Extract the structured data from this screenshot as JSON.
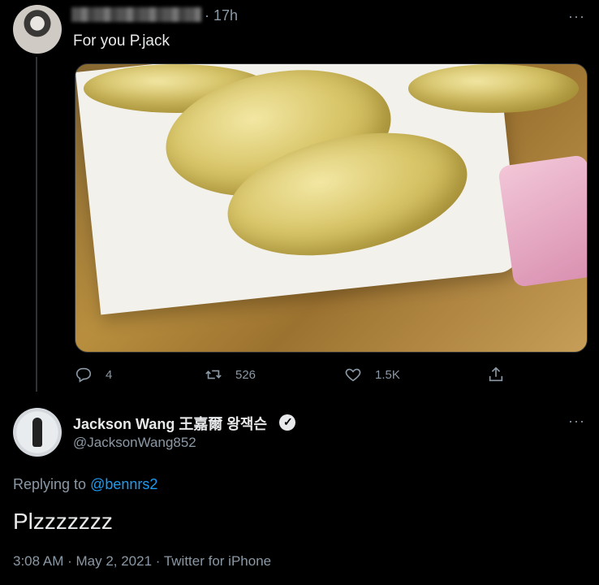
{
  "tweet1": {
    "time": "· 17h",
    "more": "···",
    "text": "For you P.jack",
    "actions": {
      "replies": "4",
      "retweets": "526",
      "likes": "1.5K"
    }
  },
  "tweet2": {
    "name": "Jackson Wang 王嘉爾 왕잭슨",
    "handle": "@JacksonWang852",
    "more": "···",
    "replying_prefix": "Replying to",
    "replying_to": "@bennrs2",
    "text": "Plzzzzzzz",
    "meta": "3:08 AM · May 2, 2021 · Twitter for iPhone"
  },
  "icons": {
    "reply": "reply-icon",
    "retweet": "retweet-icon",
    "like": "heart-icon",
    "share": "share-icon",
    "verified": "verified-badge-icon"
  },
  "colors": {
    "background": "#000000",
    "text": "#e7e9ea",
    "muted": "#8b98a5",
    "link": "#1d9bf0"
  }
}
